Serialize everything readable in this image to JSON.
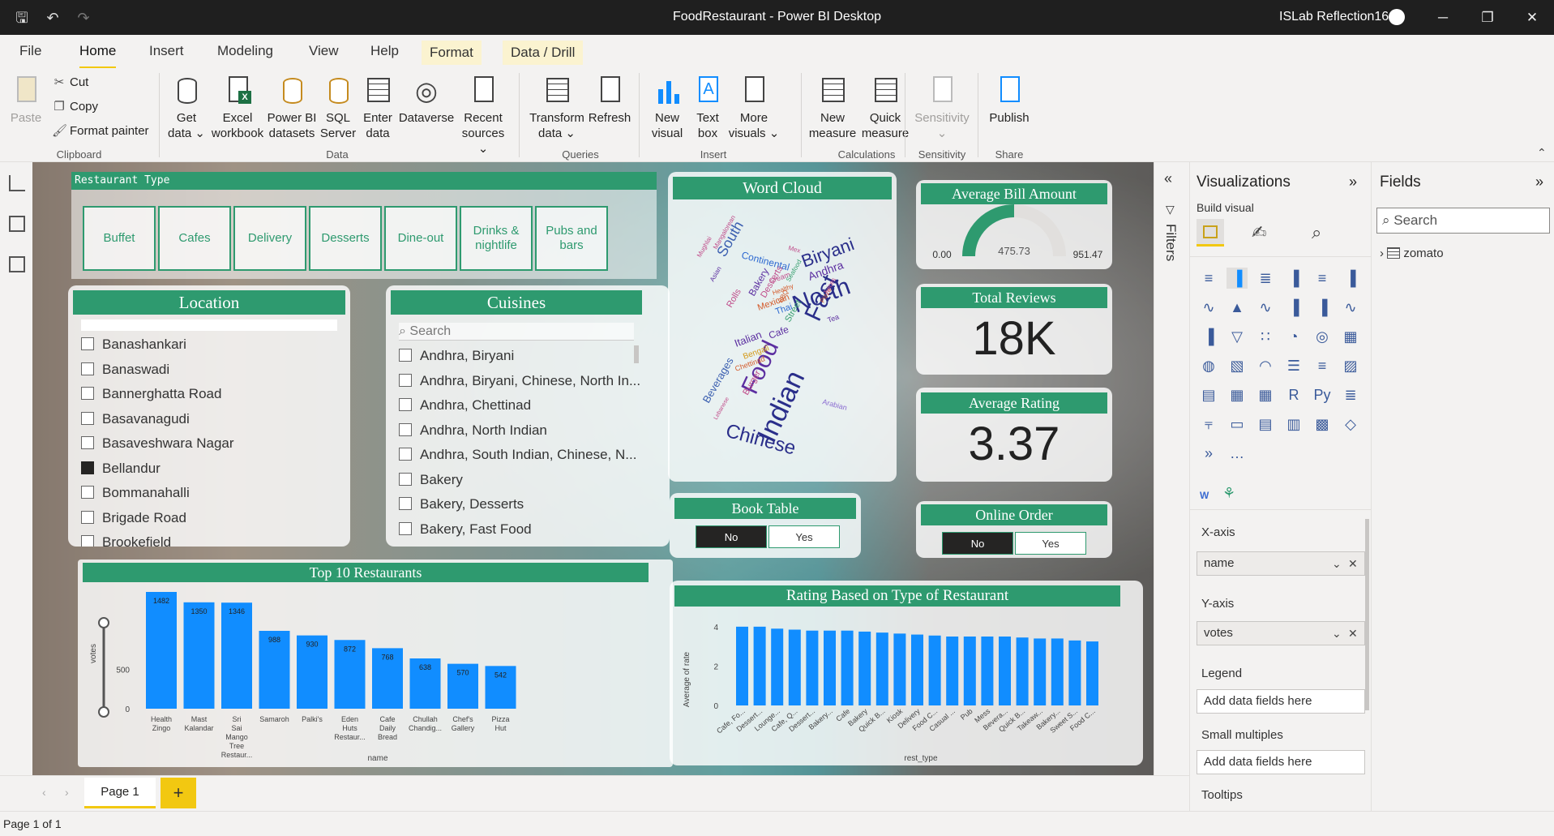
{
  "window": {
    "title": "FoodRestaurant - Power BI Desktop",
    "user": "ISLab Reflection16"
  },
  "tabs": [
    "File",
    "Home",
    "Insert",
    "Modeling",
    "View",
    "Help",
    "Format",
    "Data / Drill"
  ],
  "ribbon": {
    "clipboard": {
      "paste": "Paste",
      "cut": "Cut",
      "copy": "Copy",
      "format_painter": "Format painter",
      "label": "Clipboard"
    },
    "data": {
      "get_data": [
        "Get",
        "data"
      ],
      "excel": [
        "Excel",
        "workbook"
      ],
      "pbi_datasets": [
        "Power BI",
        "datasets"
      ],
      "sql": [
        "SQL",
        "Server"
      ],
      "enter_data": [
        "Enter",
        "data"
      ],
      "dataverse": "Dataverse",
      "recent_sources": [
        "Recent",
        "sources"
      ],
      "label": "Data"
    },
    "queries": {
      "transform": [
        "Transform",
        "data"
      ],
      "refresh": "Refresh",
      "label": "Queries"
    },
    "insert": {
      "new_visual": [
        "New",
        "visual"
      ],
      "text_box": [
        "Text",
        "box"
      ],
      "more_visuals": [
        "More",
        "visuals"
      ],
      "label": "Insert"
    },
    "calculations": {
      "new_measure": [
        "New",
        "measure"
      ],
      "quick_measure": [
        "Quick",
        "measure"
      ],
      "label": "Calculations"
    },
    "sensitivity": {
      "button": "Sensitivity",
      "label": "Sensitivity"
    },
    "share": {
      "publish": "Publish",
      "label": "Share"
    }
  },
  "report": {
    "restaurant_type": {
      "title": "Restaurant Type",
      "options": [
        "Buffet",
        "Cafes",
        "Delivery",
        "Desserts",
        "Dine-out",
        "Drinks & nightlife",
        "Pubs and bars"
      ]
    },
    "location": {
      "title": "Location",
      "items": [
        {
          "label": "Banashankari",
          "checked": false
        },
        {
          "label": "Banaswadi",
          "checked": false
        },
        {
          "label": "Bannerghatta Road",
          "checked": false
        },
        {
          "label": "Basavanagudi",
          "checked": false
        },
        {
          "label": "Basaveshwara Nagar",
          "checked": false
        },
        {
          "label": "Bellandur",
          "checked": true
        },
        {
          "label": "Bommanahalli",
          "checked": false
        },
        {
          "label": "Brigade Road",
          "checked": false
        },
        {
          "label": "Brookefield",
          "checked": false
        }
      ]
    },
    "cuisines": {
      "title": "Cuisines",
      "search_placeholder": "Search",
      "items": [
        "Andhra, Biryani",
        "Andhra, Biryani, Chinese, North In...",
        "Andhra, Chettinad",
        "Andhra, North Indian",
        "Andhra, South Indian, Chinese, N...",
        "Bakery",
        "Bakery, Desserts",
        "Bakery, Fast Food"
      ]
    },
    "word_cloud": {
      "title": "Word Cloud",
      "words": [
        "Indian",
        "North",
        "Food",
        "Fast",
        "Chinese",
        "Biryani",
        "South",
        "Andhra",
        "Beverages",
        "Continental",
        "Bakery",
        "Desserts",
        "Cafe",
        "Italian",
        "Mughlai",
        "Mexican",
        "Street",
        "Thai",
        "Rolls",
        "Burger",
        "Bengali",
        "Chettinad",
        "Mangalorean",
        "Asian",
        "Arabian",
        "Lebanese",
        "Cream",
        "Healthy",
        "Tea",
        "BBQ",
        "Mex",
        "Pizza",
        "Juices",
        "Seafood"
      ]
    },
    "avg_bill": {
      "title": "Average Bill Amount",
      "min": "0.00",
      "value": "475.73",
      "max": "951.47",
      "fraction": 0.5
    },
    "total_reviews": {
      "title": "Total Reviews",
      "value": "18K"
    },
    "avg_rating": {
      "title": "Average Rating",
      "value": "3.37"
    },
    "book_table": {
      "title": "Book Table",
      "options": [
        "No",
        "Yes"
      ],
      "selected": "No"
    },
    "online_order": {
      "title": "Online Order",
      "options": [
        "No",
        "Yes"
      ],
      "selected": "No"
    },
    "top10_title": "Top 10 Restaurants",
    "rating_title": "Rating Based on Type of Restaurant"
  },
  "chart_data": [
    {
      "type": "bar",
      "title": "Top 10 Restaurants",
      "xlabel": "name",
      "ylabel": "votes",
      "categories": [
        "Health Zingo",
        "Mast Kalandar",
        "Sri Sai Mango Tree Restaur...",
        "Samaroh",
        "Palki's",
        "Eden Huts Restaur...",
        "Cafe Daily Bread",
        "Chullah Chandig...",
        "Chef's Gallery",
        "Pizza Hut"
      ],
      "values": [
        1482,
        1350,
        1346,
        988,
        930,
        872,
        768,
        638,
        570,
        542
      ],
      "yticks": [
        "0",
        "500"
      ],
      "ylim": [
        0,
        1482
      ],
      "color": "#118dff"
    },
    {
      "type": "bar",
      "title": "Rating Based on Type of Restaurant",
      "xlabel": "rest_type",
      "ylabel": "Average of rate",
      "categories": [
        "Cafe, Fo...",
        "Dessert...",
        "Lounge...",
        "Cafe, Q...",
        "Dessert...",
        "Bakery...",
        "Cafe",
        "Bakery",
        "Quick B...",
        "Kiosk",
        "Delivery",
        "Food C...",
        "Casual ...",
        "Pub",
        "Mess",
        "Bevera...",
        "Quick B...",
        "Takeaw...",
        "Bakery...",
        "Sweet S...",
        "Food C..."
      ],
      "values": [
        4.0,
        4.0,
        3.9,
        3.85,
        3.8,
        3.8,
        3.8,
        3.75,
        3.7,
        3.65,
        3.6,
        3.55,
        3.5,
        3.5,
        3.5,
        3.5,
        3.45,
        3.4,
        3.4,
        3.3,
        3.25
      ],
      "yticks": [
        "0",
        "2",
        "4"
      ],
      "ylim": [
        0,
        4.2
      ],
      "color": "#118dff"
    }
  ],
  "filters_label": "Filters",
  "visualizations": {
    "title": "Visualizations",
    "build_visual": "Build visual",
    "x_axis": {
      "label": "X-axis",
      "field": "name"
    },
    "y_axis": {
      "label": "Y-axis",
      "field": "votes"
    },
    "legend": {
      "label": "Legend",
      "placeholder": "Add data fields here"
    },
    "small_multiples": {
      "label": "Small multiples",
      "placeholder": "Add data fields here"
    },
    "tooltips": {
      "label": "Tooltips"
    }
  },
  "fields": {
    "title": "Fields",
    "search_placeholder": "Search",
    "table": "zomato"
  },
  "pages": {
    "page1": "Page 1",
    "add": "+"
  },
  "status": "Page 1 of 1"
}
